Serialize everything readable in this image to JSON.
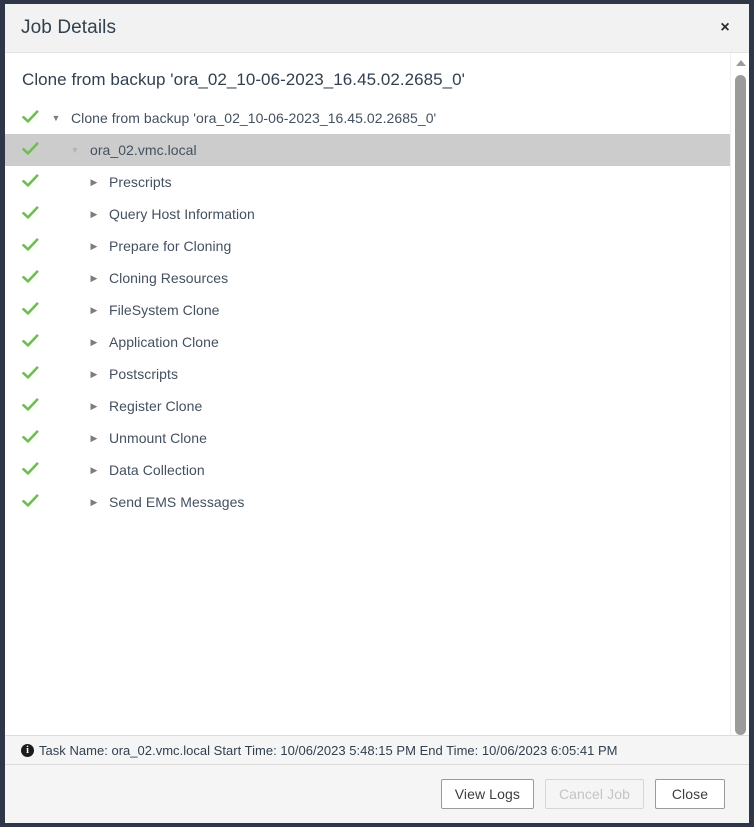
{
  "window": {
    "title": "Job Details",
    "close_label": "×"
  },
  "content": {
    "heading": "Clone from backup 'ora_02_10-06-2023_16.45.02.2685_0'"
  },
  "tree": {
    "nodes": [
      {
        "label": "Clone from backup 'ora_02_10-06-2023_16.45.02.2685_0'",
        "depth": 0,
        "status": "success",
        "expander": "▼",
        "expanded": true,
        "selected": false
      },
      {
        "label": "ora_02.vmc.local",
        "depth": 1,
        "status": "success",
        "expander": "▼",
        "expanded": true,
        "selected": true
      },
      {
        "label": "Prescripts",
        "depth": 2,
        "status": "success",
        "expander": "▶",
        "expanded": false,
        "selected": false
      },
      {
        "label": "Query Host Information",
        "depth": 2,
        "status": "success",
        "expander": "▶",
        "expanded": false,
        "selected": false
      },
      {
        "label": "Prepare for Cloning",
        "depth": 2,
        "status": "success",
        "expander": "▶",
        "expanded": false,
        "selected": false
      },
      {
        "label": "Cloning Resources",
        "depth": 2,
        "status": "success",
        "expander": "▶",
        "expanded": false,
        "selected": false
      },
      {
        "label": "FileSystem Clone",
        "depth": 2,
        "status": "success",
        "expander": "▶",
        "expanded": false,
        "selected": false
      },
      {
        "label": "Application Clone",
        "depth": 2,
        "status": "success",
        "expander": "▶",
        "expanded": false,
        "selected": false
      },
      {
        "label": "Postscripts",
        "depth": 2,
        "status": "success",
        "expander": "▶",
        "expanded": false,
        "selected": false
      },
      {
        "label": "Register Clone",
        "depth": 2,
        "status": "success",
        "expander": "▶",
        "expanded": false,
        "selected": false
      },
      {
        "label": "Unmount Clone",
        "depth": 2,
        "status": "success",
        "expander": "▶",
        "expanded": false,
        "selected": false
      },
      {
        "label": "Data Collection",
        "depth": 2,
        "status": "success",
        "expander": "▶",
        "expanded": false,
        "selected": false
      },
      {
        "label": "Send EMS Messages",
        "depth": 2,
        "status": "success",
        "expander": "▶",
        "expanded": false,
        "selected": false
      }
    ]
  },
  "statusbar": {
    "text": "Task Name: ora_02.vmc.local Start Time: 10/06/2023 5:48:15 PM End Time: 10/06/2023 6:05:41 PM",
    "info_glyph": "i"
  },
  "footer": {
    "buttons": [
      {
        "label": "View Logs",
        "disabled": false
      },
      {
        "label": "Cancel Job",
        "disabled": true
      },
      {
        "label": "Close",
        "disabled": false
      }
    ]
  },
  "colors": {
    "success_check": "#6cc04a",
    "selected_row": "#cccccc",
    "title_text": "#32404f",
    "window_border": "#2e3647"
  }
}
